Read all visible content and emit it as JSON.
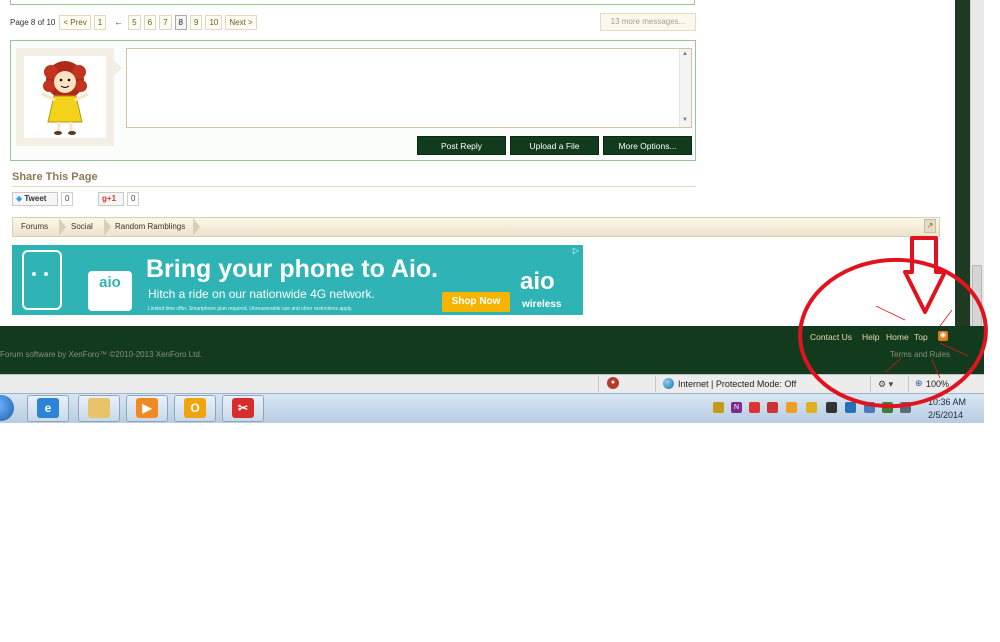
{
  "pagination": {
    "label": "Page 8 of 10",
    "prev": "< Prev",
    "first": "1",
    "ellipsis": "←",
    "pages": [
      "5",
      "6",
      "7",
      "8",
      "9",
      "10"
    ],
    "current": "8",
    "next": "Next >",
    "more_messages": "13 more messages..."
  },
  "reply": {
    "buttons": [
      "Post Reply",
      "Upload a File",
      "More Options..."
    ]
  },
  "share": {
    "title": "Share This Page",
    "tweet": "Tweet",
    "tweet_count": "0",
    "gplus": "+1",
    "gplus_count": "0"
  },
  "breadcrumb": [
    "Forums",
    "Social",
    "Random Ramblings"
  ],
  "ad": {
    "headline": "Bring your phone to Aio.",
    "subline": "Hitch a ride on our nationwide 4G network.",
    "fine_print": "Limited time offer. Smartphone plan required. Unreasonable use and other restrictions apply.",
    "cta": "Shop Now",
    "brand": "aio",
    "brand_sub": "wireless",
    "logo_text": "aio",
    "ad_choice": "▷"
  },
  "footer": {
    "links": [
      "Contact Us",
      "Help",
      "Home",
      "Top"
    ],
    "copyright": "Forum software by XenForo™ ©2010-2013 XenForo Ltd.",
    "terms": "Terms and Rules"
  },
  "statusbar": {
    "zone": "Internet | Protected Mode: Off",
    "zoom": "100%"
  },
  "taskbar": {
    "time": "10:36 AM",
    "date": "2/5/2014"
  },
  "colors": {
    "forum_green": "#123a1d",
    "border_green": "#9ac39a",
    "annotation_red": "#e0141e"
  }
}
